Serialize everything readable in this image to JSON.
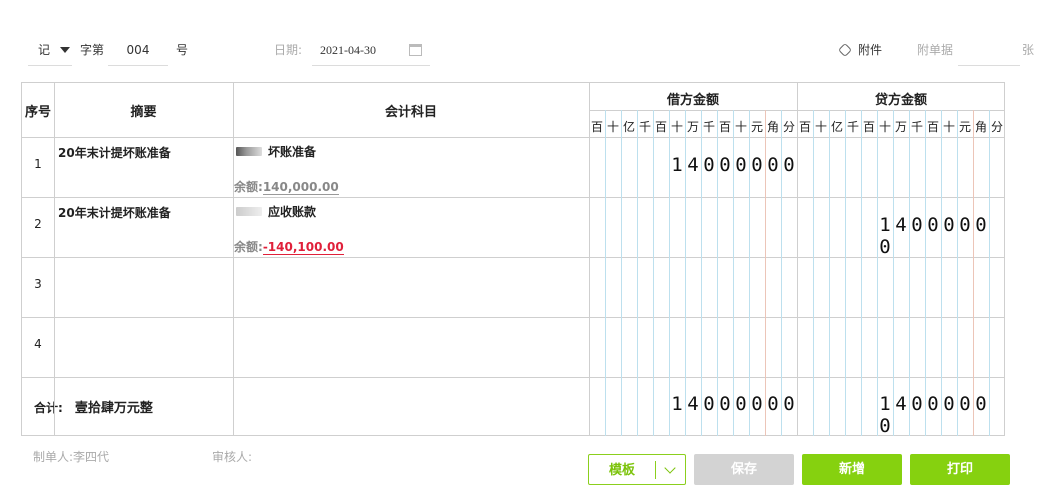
{
  "header": {
    "word": "记",
    "zi_di": "字第",
    "number": "004",
    "hao": "号",
    "date_label": "日期:",
    "date": "2021-04-30",
    "attachment": "附件",
    "docs_placeholder": "附单据",
    "zhang": "张"
  },
  "table": {
    "col_seq": "序号",
    "col_summary": "摘要",
    "col_account": "会计科目",
    "col_debit": "借方金额",
    "col_credit": "贷方金额",
    "digits": [
      "百",
      "十",
      "亿",
      "千",
      "百",
      "十",
      "万",
      "千",
      "百",
      "十",
      "元",
      "角",
      "分"
    ],
    "balance_label": "余额:",
    "rows": [
      {
        "no": "1",
        "summary": "20年末计提坏账准备",
        "account": "坏账准备",
        "balance": "140,000.00",
        "balance_negative": false,
        "debit": "14000000",
        "credit": ""
      },
      {
        "no": "2",
        "summary": "20年末计提坏账准备",
        "account": "应收账款",
        "balance": "-140,100.00",
        "balance_negative": true,
        "debit": "",
        "credit": "14000000"
      },
      {
        "no": "3",
        "summary": "",
        "account": "",
        "balance": "",
        "debit": "",
        "credit": ""
      },
      {
        "no": "4",
        "summary": "",
        "account": "",
        "balance": "",
        "debit": "",
        "credit": ""
      }
    ],
    "total_label": "合计:",
    "total_words": "壹拾肆万元整",
    "total_debit": "14000000",
    "total_credit": "14000000"
  },
  "footer": {
    "maker_label": "制单人:",
    "maker": "李四代",
    "reviewer_label": "审核人:",
    "template_btn": "模板",
    "save_btn": "保存",
    "new_btn": "新增",
    "print_btn": "打印"
  },
  "colors": {
    "accent": "#86d10f",
    "negative": "#e0203a",
    "disabled": "#d3d3d3"
  }
}
